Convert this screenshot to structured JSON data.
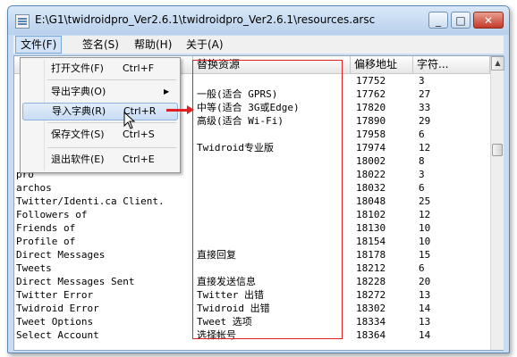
{
  "window": {
    "title": "E:\\G1\\twidroidpro_Ver2.6.1\\twidroidpro_Ver2.6.1\\resources.arsc"
  },
  "menubar": [
    {
      "label": "文件(F)"
    },
    {
      "label": "签名(S)"
    },
    {
      "label": "帮助(H)"
    },
    {
      "label": "关于(A)"
    }
  ],
  "file_menu": [
    {
      "label": "打开文件(F)",
      "shortcut": "Ctrl+F"
    },
    {
      "label": "导出字典(O)",
      "shortcut": ""
    },
    {
      "label": "导入字典(R)",
      "shortcut": "Ctrl+R"
    },
    {
      "label": "保存文件(S)",
      "shortcut": "Ctrl+S"
    },
    {
      "label": "退出软件(E)",
      "shortcut": "Ctrl+E"
    }
  ],
  "table": {
    "columns": [
      "",
      "替换资源",
      "偏移地址",
      "字符..."
    ],
    "rows": [
      [
        "",
        "",
        "17752",
        "3"
      ],
      [
        "",
        "一般(适合 GPRS)",
        "17762",
        "27"
      ],
      [
        "",
        "中等(适合 3G或Edge)",
        "17820",
        "33"
      ],
      [
        "",
        "高级(适合 Wi-Fi)",
        "17890",
        "29"
      ],
      [
        "",
        "",
        "17958",
        "6"
      ],
      [
        "",
        "Twidroid专业版",
        "17974",
        "12"
      ],
      [
        "",
        "",
        "18002",
        "8"
      ],
      [
        "pro",
        "",
        "18022",
        "3"
      ],
      [
        "archos",
        "",
        "18032",
        "6"
      ],
      [
        "Twitter/Identi.ca Client.",
        "",
        "18048",
        "25"
      ],
      [
        "Followers of",
        "",
        "18102",
        "12"
      ],
      [
        "Friends of",
        "",
        "18130",
        "10"
      ],
      [
        "Profile of",
        "",
        "18154",
        "10"
      ],
      [
        "Direct Messages",
        "直接回复",
        "18178",
        "15"
      ],
      [
        "Tweets",
        "",
        "18212",
        "6"
      ],
      [
        "Direct Messages Sent",
        "直接发送信息",
        "18228",
        "20"
      ],
      [
        "Twitter Error",
        "Twitter 出错",
        "18272",
        "13"
      ],
      [
        "Twidroid Error",
        "Twidroid 出错",
        "18302",
        "14"
      ],
      [
        "Tweet Options",
        "Tweet 选项",
        "18334",
        "13"
      ],
      [
        "Select Account",
        "选择帐号",
        "18364",
        "14"
      ]
    ]
  },
  "colors": {
    "highlight_box": "#e02020",
    "menu_highlight": "#c8dcf4"
  },
  "icons": {
    "window": [
      "app-icon",
      "minimize-icon",
      "maximize-icon",
      "close-icon"
    ],
    "menu": [
      "submenu-arrow-icon",
      "mouse-cursor-icon",
      "red-arrow-icon"
    ]
  }
}
